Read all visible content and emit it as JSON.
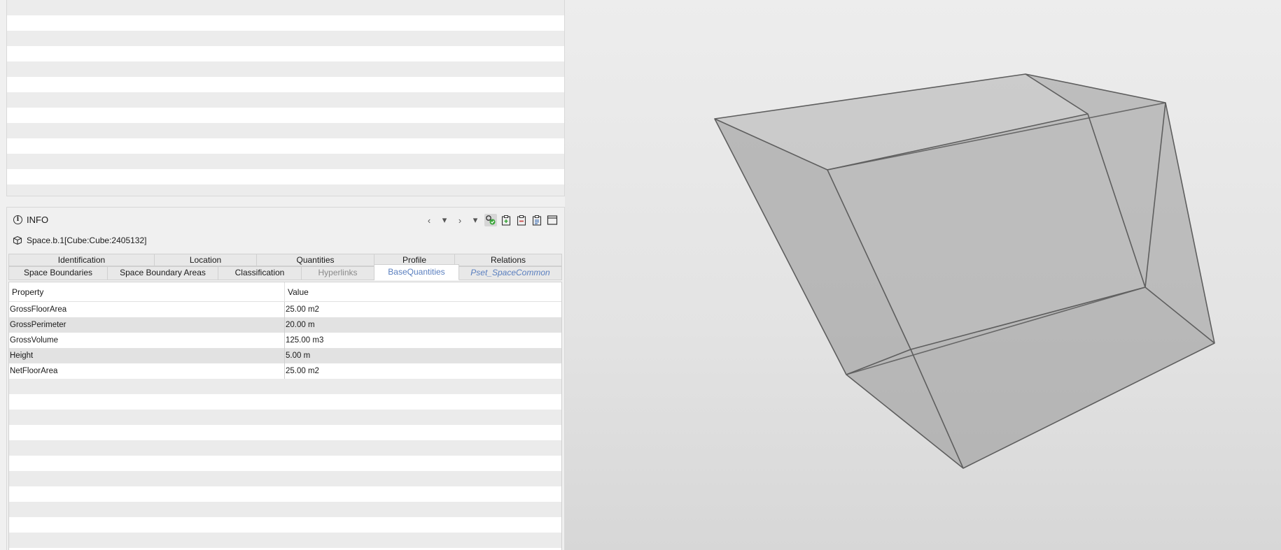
{
  "info_panel": {
    "title": "INFO",
    "entity": "Space.b.1[Cube:Cube:2405132]",
    "toolbar": {
      "back": "‹",
      "back_menu": "▾",
      "forward": "›",
      "forward_menu": "▾"
    }
  },
  "tabs": {
    "row1": [
      {
        "label": "Identification"
      },
      {
        "label": "Location"
      },
      {
        "label": "Quantities"
      },
      {
        "label": "Profile"
      },
      {
        "label": "Relations"
      }
    ],
    "row2": [
      {
        "label": "Space Boundaries"
      },
      {
        "label": "Space Boundary Areas"
      },
      {
        "label": "Classification"
      },
      {
        "label": "Hyperlinks"
      },
      {
        "label": "BaseQuantities"
      },
      {
        "label": "Pset_SpaceCommon"
      }
    ],
    "selected": "BaseQuantities"
  },
  "table": {
    "headers": {
      "property": "Property",
      "value": "Value"
    },
    "rows": [
      {
        "property": "GrossFloorArea",
        "value": "25.00 m2"
      },
      {
        "property": "GrossPerimeter",
        "value": "20.00 m"
      },
      {
        "property": "GrossVolume",
        "value": "125.00 m3"
      },
      {
        "property": "Height",
        "value": "5.00 m"
      },
      {
        "property": "NetFloorArea",
        "value": "25.00 m2"
      }
    ]
  },
  "colors": {
    "accent": "#5a7fbf",
    "cube_face": "#a6a6a6",
    "cube_edge": "#5e5e5e",
    "toolbar_green": "#3aa53a",
    "toolbar_red": "#c84a4a",
    "toolbar_blue": "#3f6fb5"
  }
}
